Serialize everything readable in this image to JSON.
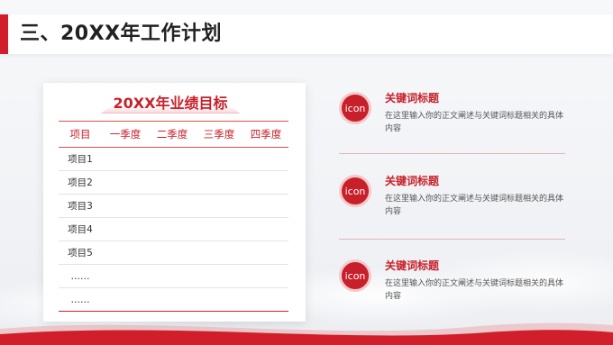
{
  "slide": {
    "title": "三、20XX年工作计划",
    "accent_color": "#d01f2a"
  },
  "table_card": {
    "title": "20XX年业绩目标",
    "headers": [
      "项目",
      "一季度",
      "二季度",
      "三季度",
      "四季度"
    ],
    "rows": [
      [
        "项目1",
        "",
        "",
        "",
        ""
      ],
      [
        "项目2",
        "",
        "",
        "",
        ""
      ],
      [
        "项目3",
        "",
        "",
        "",
        ""
      ],
      [
        "项目4",
        "",
        "",
        "",
        ""
      ],
      [
        "项目5",
        "",
        "",
        "",
        ""
      ],
      [
        "……",
        "",
        "",
        "",
        ""
      ],
      [
        "……",
        "",
        "",
        "",
        ""
      ]
    ]
  },
  "items": [
    {
      "icon_label": "icon",
      "title": "关键词标题",
      "desc": "在这里输入你的正文阐述与关键词标题相关的具体内容"
    },
    {
      "icon_label": "icon",
      "title": "关键词标题",
      "desc": "在这里输入你的正文阐述与关键词标题相关的具体内容"
    },
    {
      "icon_label": "icon",
      "title": "关键词标题",
      "desc": "在这里输入你的正文阐述与关键词标题相关的具体内容"
    }
  ]
}
